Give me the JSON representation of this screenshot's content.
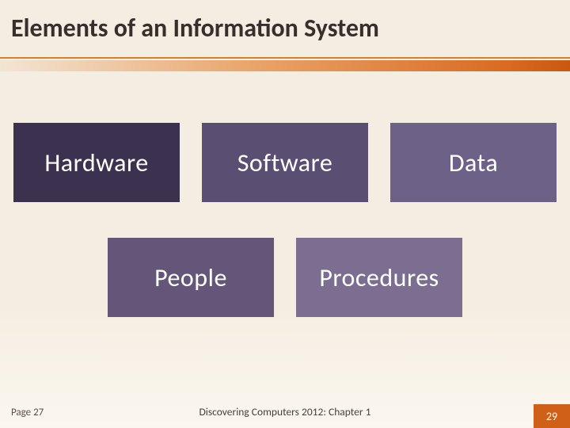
{
  "title": "Elements of an Information System",
  "tiles": {
    "row1": [
      {
        "label": "Hardware"
      },
      {
        "label": "Software"
      },
      {
        "label": "Data"
      }
    ],
    "row2": [
      {
        "label": "People"
      },
      {
        "label": "Procedures"
      }
    ]
  },
  "footer": {
    "page_left": "Page 27",
    "center": "Discovering Computers 2012: Chapter 1",
    "slide_number": "29"
  },
  "colors": {
    "accent_orange": "#d06018",
    "tile_shades": [
      "#3d3150",
      "#5b4e73",
      "#6e6188",
      "#645679",
      "#7b6e91"
    ]
  }
}
